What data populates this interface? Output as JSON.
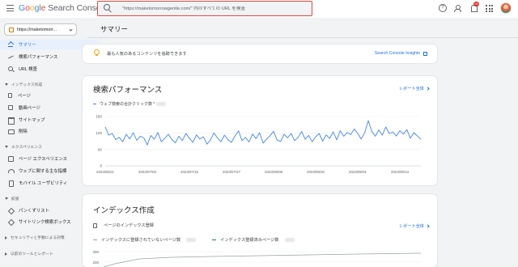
{
  "app": {
    "logo_parts": [
      "G",
      "o",
      "o",
      "g",
      "l",
      "e"
    ],
    "logo_rest": " Search Console"
  },
  "search": {
    "placeholder": "\"https://maketomorrowgentle.com/\" 内のすべての URL を検査"
  },
  "header_icons": [
    "help-icon",
    "people-icon",
    "bell-icon",
    "apps-grid-icon",
    "avatar"
  ],
  "notifications": {
    "count": "93"
  },
  "property": {
    "label": "https://maketomorr..."
  },
  "sidebar": {
    "items": [
      {
        "label": "サマリー",
        "icon": "home-icon",
        "active": true
      },
      {
        "label": "検索パフォーマンス",
        "icon": "trending-icon"
      },
      {
        "label": "URL 検査",
        "icon": "search-icon"
      }
    ],
    "sections": [
      {
        "label": "インデックス作成",
        "items": [
          "ページ",
          "動画ページ",
          "サイトマップ",
          "削除"
        ]
      },
      {
        "label": "エクスペリエンス",
        "items": [
          "ページ エクスペリエンス",
          "ウェブに関する主な指標",
          "モバイル ユーザビリティ"
        ]
      },
      {
        "label": "拡張",
        "items": [
          "パンくずリスト",
          "サイトリンク検索ボックス"
        ]
      },
      {
        "label": "セキュリティと手動による対策"
      },
      {
        "label": "以前のツールとレポート"
      }
    ]
  },
  "main": {
    "title": "サマリー",
    "insight": {
      "text": "最も人気のあるコンテンツを追跡できます",
      "link": "Search Console Insights"
    },
    "performance": {
      "title": "検索パフォーマンス",
      "link": "レポート全体",
      "legend": "ウェブ検索の合計クリック数 *"
    },
    "indexing": {
      "title": "インデックス作成",
      "sub": "ページのインデックス登録",
      "link": "レポート全体",
      "legend_not_indexed": "インデックスに登録されていないページ数",
      "legend_indexed": "インデックス登録済みページ数",
      "y_ticks": [
        "300",
        "200"
      ]
    }
  },
  "chart_data": {
    "type": "line",
    "title": "",
    "xlabel": "",
    "ylabel": "",
    "ylim": [
      0,
      180
    ],
    "y_ticks": [
      "0",
      "60",
      "120",
      "180"
    ],
    "x_ticks": [
      "2023/06/21",
      "2023/07/03",
      "2023/07/15",
      "2023/07/27",
      "2023/08/08",
      "2023/08/20",
      "2023/09/01",
      "2023/09/13"
    ],
    "grid": true,
    "series": [
      {
        "name": "ウェブ検索の合計クリック数",
        "color": "#4285f4",
        "x": [
          "2023/06/21",
          "2023/06/22",
          "2023/06/23",
          "2023/06/24",
          "2023/06/25",
          "2023/06/26",
          "2023/06/27",
          "2023/06/28",
          "2023/06/29",
          "2023/06/30",
          "2023/07/01",
          "2023/07/02",
          "2023/07/03",
          "2023/07/04",
          "2023/07/05",
          "2023/07/06",
          "2023/07/07",
          "2023/07/08",
          "2023/07/09",
          "2023/07/10",
          "2023/07/11",
          "2023/07/12",
          "2023/07/13",
          "2023/07/14",
          "2023/07/15",
          "2023/07/16",
          "2023/07/17",
          "2023/07/18",
          "2023/07/19",
          "2023/07/20",
          "2023/07/21",
          "2023/07/22",
          "2023/07/23",
          "2023/07/24",
          "2023/07/25",
          "2023/07/26",
          "2023/07/27",
          "2023/07/28",
          "2023/07/29",
          "2023/07/30",
          "2023/07/31",
          "2023/08/01",
          "2023/08/02",
          "2023/08/03",
          "2023/08/04",
          "2023/08/05",
          "2023/08/06",
          "2023/08/07",
          "2023/08/08",
          "2023/08/09",
          "2023/08/10",
          "2023/08/11",
          "2023/08/12",
          "2023/08/13",
          "2023/08/14",
          "2023/08/15",
          "2023/08/16",
          "2023/08/17",
          "2023/08/18",
          "2023/08/19",
          "2023/08/20",
          "2023/08/21",
          "2023/08/22",
          "2023/08/23",
          "2023/08/24",
          "2023/08/25",
          "2023/08/26",
          "2023/08/27",
          "2023/08/28",
          "2023/08/29",
          "2023/08/30",
          "2023/08/31",
          "2023/09/01",
          "2023/09/02",
          "2023/09/03",
          "2023/09/04",
          "2023/09/05",
          "2023/09/06",
          "2023/09/07",
          "2023/09/08",
          "2023/09/09",
          "2023/09/10",
          "2023/09/11",
          "2023/09/12",
          "2023/09/13",
          "2023/09/14",
          "2023/09/15",
          "2023/09/16",
          "2023/09/17",
          "2023/09/18",
          "2023/09/19"
        ],
        "values": [
          142,
          112,
          118,
          96,
          104,
          88,
          115,
          98,
          121,
          93,
          108,
          102,
          76,
          111,
          97,
          122,
          88,
          101,
          115,
          96,
          84,
          108,
          92,
          118,
          101,
          86,
          113,
          98,
          106,
          79,
          94,
          120,
          102,
          88,
          112,
          95,
          86,
          109,
          128,
          92,
          104,
          87,
          116,
          99,
          121,
          83,
          97,
          110,
          126,
          94,
          89,
          115,
          102,
          118,
          92,
          104,
          125,
          97,
          111,
          88,
          106,
          118,
          90,
          113,
          100,
          124,
          95,
          128,
          108,
          122,
          114,
          135,
          118,
          98,
          122,
          165,
          126,
          108,
          131,
          112,
          142,
          118,
          124,
          109,
          128,
          116,
          132,
          101,
          121,
          109,
          97
        ]
      }
    ]
  }
}
